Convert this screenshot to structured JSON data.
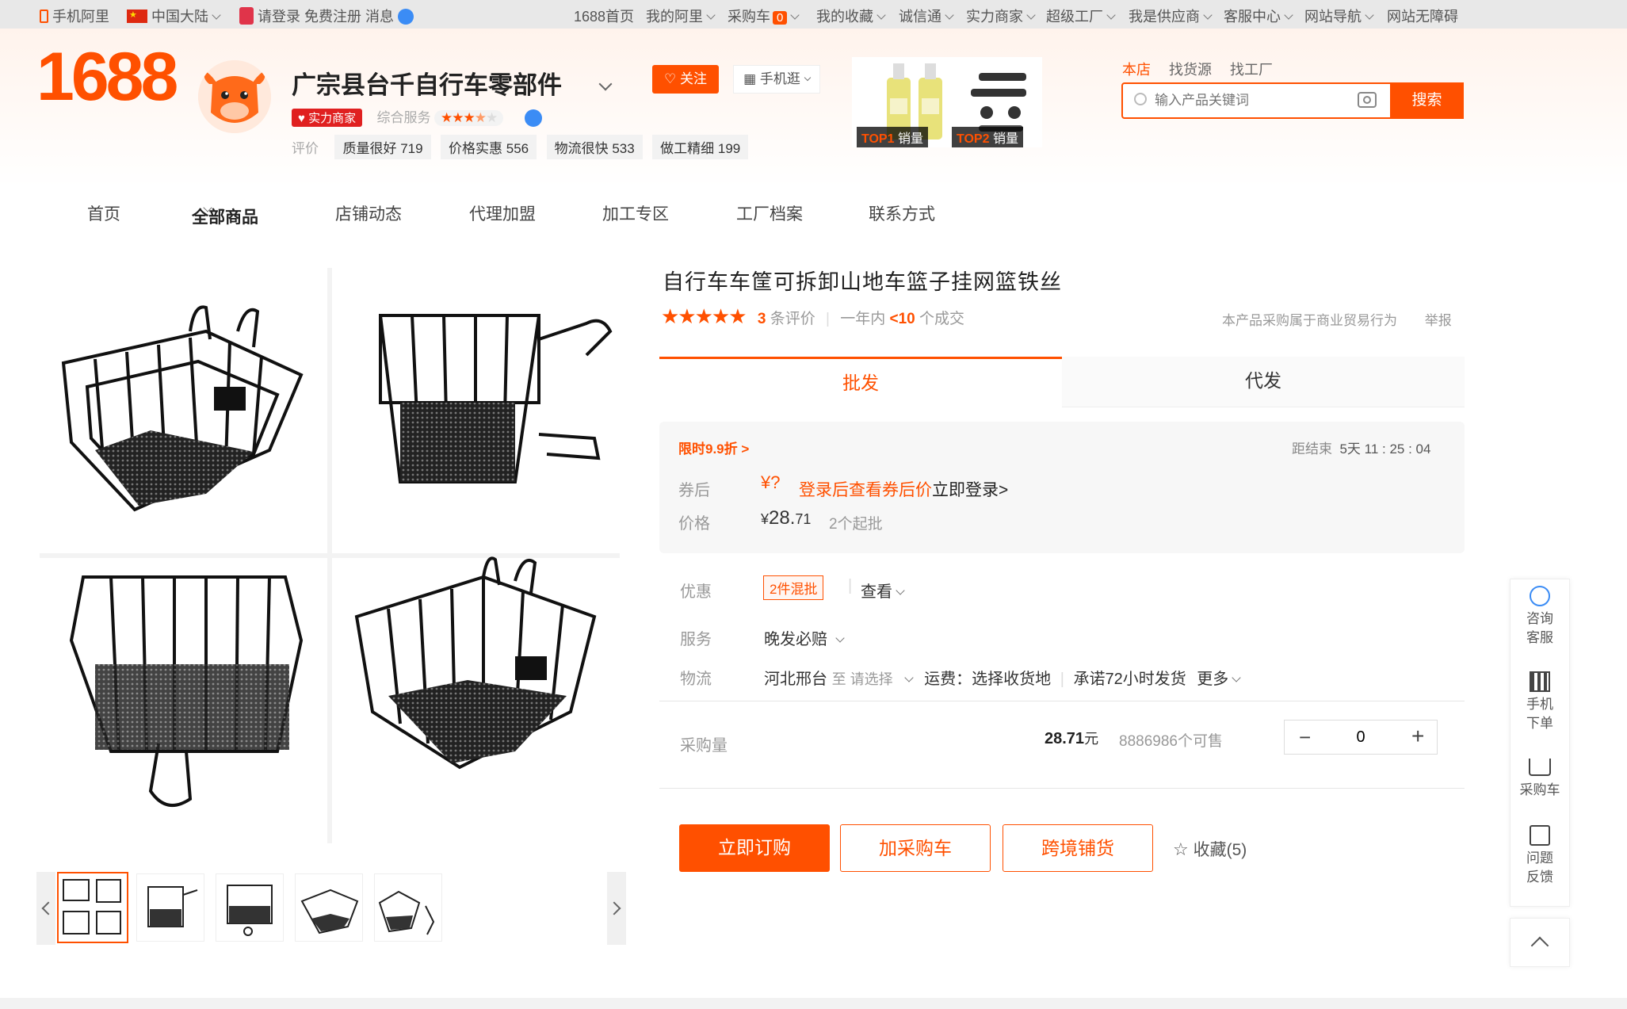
{
  "colors": {
    "accent": "#ff5000",
    "badge_red": "#e02020"
  },
  "topbar": {
    "mobile_ali": "手机阿里",
    "region": "中国大陆",
    "login": "请登录",
    "register": "免费注册",
    "messages": "消息",
    "links": [
      "1688首页",
      "我的阿里",
      "采购车",
      "我的收藏",
      "诚信通",
      "实力商家",
      "超级工厂",
      "我是供应商",
      "客服中心",
      "网站导航",
      "网站无障碍"
    ],
    "cart_count": "0"
  },
  "header": {
    "logo": "1688",
    "shop_name": "广宗县台千自行车零部件",
    "power_badge": "实力商家",
    "service_label": "综合服务",
    "eval_label": "评价",
    "ratings": [
      {
        "label": "质量很好",
        "count": "719"
      },
      {
        "label": "价格实惠",
        "count": "556"
      },
      {
        "label": "物流很快",
        "count": "533"
      },
      {
        "label": "做工精细",
        "count": "199"
      }
    ],
    "follow": "关注",
    "mobile": "手机逛",
    "top1": {
      "tag": "TOP1",
      "text": "销量"
    },
    "top2": {
      "tag": "TOP2",
      "text": "销量"
    }
  },
  "search": {
    "tabs": [
      "本店",
      "找货源",
      "找工厂"
    ],
    "placeholder": "输入产品关键词",
    "button": "搜索"
  },
  "nav": {
    "items": [
      "首页",
      "全部商品",
      "店铺动态",
      "代理加盟",
      "加工专区",
      "工厂档案",
      "联系方式"
    ]
  },
  "product": {
    "title": "自行车车筐可拆卸山地车篮子挂网篮铁丝",
    "review_count": "3",
    "review_label": "条评价",
    "deals_prefix": "一年内",
    "deals_count": "<10",
    "deals_suffix": "个成交",
    "trade_note": "本产品采购属于商业贸易行为",
    "report": "举报",
    "tabs": [
      "批发",
      "代发"
    ],
    "promo": "限时9.9折 >",
    "countdown_label": "距结束",
    "countdown_value": "5天 11 : 25 : 04",
    "coupon_label": "券后",
    "coupon_price": "¥?",
    "coupon_link": "登录后查看券后价",
    "login_now": "立即登录>",
    "price_label": "价格",
    "price_symbol": "¥",
    "price_int": "28.",
    "price_dec": "71",
    "min_order": "2个起批",
    "discount_label": "优惠",
    "discount_tag": "2件混批",
    "discount_view": "查看",
    "service_label": "服务",
    "service_value": "晚发必赔",
    "logistics_label": "物流",
    "logistics_from": "河北邢台",
    "logistics_to": "至 请选择",
    "shipping": "运费：选择收货地",
    "promise": "承诺72小时发货",
    "more": "更多",
    "qty_label": "采购量",
    "qty_price": "28.71",
    "qty_unit": "元",
    "stock": "8886986个可售",
    "qty_value": "0",
    "btn_order": "立即订购",
    "btn_cart": "加采购车",
    "btn_cross": "跨境铺货",
    "favorite": "收藏(5)"
  },
  "sidebar": {
    "consult": [
      "咨询",
      "客服"
    ],
    "mobile": [
      "手机",
      "下单"
    ],
    "cart": "采购车",
    "feedback": [
      "问题",
      "反馈"
    ]
  }
}
